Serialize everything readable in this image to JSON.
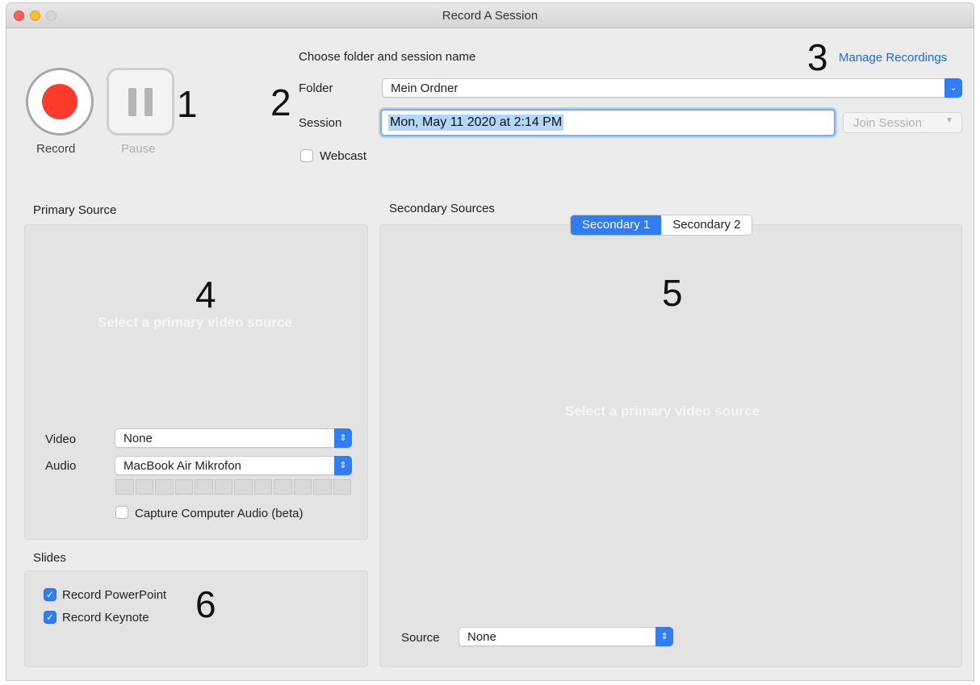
{
  "window": {
    "title": "Record A Session"
  },
  "controls": {
    "record_label": "Record",
    "pause_label": "Pause"
  },
  "callouts": {
    "n1": "1",
    "n2": "2",
    "n3": "3",
    "n4": "4",
    "n5": "5",
    "n6": "6"
  },
  "session_setup": {
    "heading": "Choose folder and session name",
    "folder_label": "Folder",
    "folder_value": "Mein Ordner",
    "session_label": "Session",
    "session_value": "Mon, May 11 2020 at 2:14 PM",
    "join_button": "Join Session",
    "webcast_label": "Webcast",
    "webcast_checked": false
  },
  "manage_link": "Manage Recordings",
  "primary": {
    "heading": "Primary Source",
    "placeholder": "Select a primary video source",
    "video_label": "Video",
    "video_value": "None",
    "audio_label": "Audio",
    "audio_value": "MacBook Air Mikrofon",
    "capture_label": "Capture Computer Audio (beta)",
    "capture_checked": false
  },
  "slides": {
    "heading": "Slides",
    "powerpoint_label": "Record PowerPoint",
    "powerpoint_checked": true,
    "keynote_label": "Record Keynote",
    "keynote_checked": true
  },
  "secondary": {
    "heading": "Secondary Sources",
    "tabs": [
      "Secondary 1",
      "Secondary 2"
    ],
    "active_tab": "Secondary 1",
    "placeholder": "Select a primary video source",
    "source_label": "Source",
    "source_value": "None"
  },
  "colors": {
    "accent": "#2f7ef7",
    "record": "#fd3b2b",
    "link": "#1a6fe0"
  }
}
